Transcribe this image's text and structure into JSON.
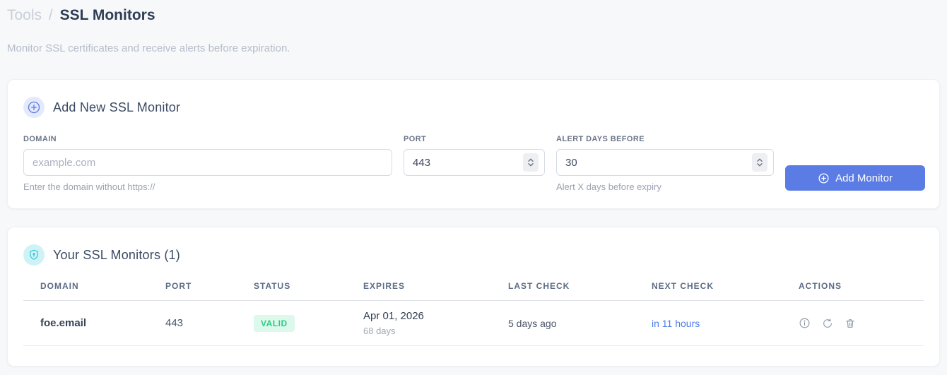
{
  "page": {
    "breadcrumb": {
      "section": "Tools",
      "separator": "/",
      "current": "SSL Monitors"
    },
    "subtitle": "Monitor SSL certificates and receive alerts before expiration."
  },
  "colors": {
    "accent_blue": "#5b7ce4",
    "valid_green_text": "#2fcb87",
    "valid_green_bg": "#ddf9ec",
    "shield_cyan": "#2fc5d6",
    "page_bg": "#f7f8fa"
  },
  "add_monitor_card": {
    "icon": "plus-circle-icon",
    "title": "Add New SSL Monitor",
    "fields": {
      "domain": {
        "label": "DOMAIN",
        "placeholder": "example.com",
        "helper": "Enter the domain without https://"
      },
      "port": {
        "label": "PORT",
        "value": "443"
      },
      "alert_days": {
        "label": "ALERT DAYS BEFORE",
        "value": "30",
        "helper": "Alert X days before expiry"
      }
    },
    "submit_label": "Add Monitor"
  },
  "monitors_card": {
    "icon": "shield-icon",
    "title": "Your SSL Monitors (1)",
    "table": {
      "columns": [
        "DOMAIN",
        "PORT",
        "STATUS",
        "EXPIRES",
        "LAST CHECK",
        "NEXT CHECK",
        "ACTIONS"
      ],
      "rows": [
        {
          "domain": "foe.email",
          "port": "443",
          "status": "VALID",
          "expires_date": "Apr 01, 2026",
          "expires_in": "68 days",
          "last_check": "5 days ago",
          "next_check": "in 11 hours",
          "actions": [
            "info-icon",
            "refresh-icon",
            "trash-icon"
          ]
        }
      ]
    }
  }
}
